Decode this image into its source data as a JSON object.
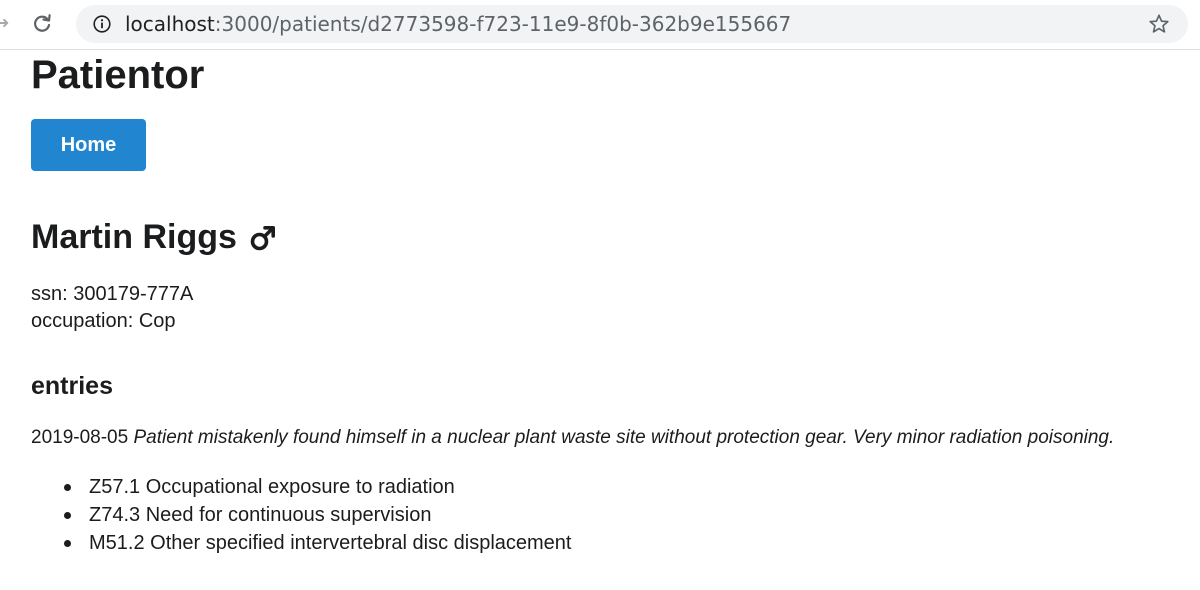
{
  "browser": {
    "url_host": "localhost",
    "url_path": ":3000/patients/d2773598-f723-11e9-8f0b-362b9e155667",
    "icons": {
      "back": "arrow-left-icon",
      "reload": "reload-icon",
      "info": "info-icon",
      "bookmark": "star-icon"
    }
  },
  "app": {
    "title": "Patientor",
    "home_button_label": "Home",
    "accent_color": "#2185d0"
  },
  "patient": {
    "name": "Martin Riggs",
    "gender_icon": "mars-icon",
    "ssn_label": "ssn:",
    "ssn": "300179-777A",
    "occupation_label": "occupation:",
    "occupation": "Cop"
  },
  "entries": {
    "heading": "entries",
    "items": [
      {
        "date": "2019-08-05",
        "description": "Patient mistakenly found himself in a nuclear plant waste site without protection gear. Very minor radiation poisoning.",
        "diagnoses": [
          {
            "code": "Z57.1",
            "name": "Occupational exposure to radiation"
          },
          {
            "code": "Z74.3",
            "name": "Need for continuous supervision"
          },
          {
            "code": "M51.2",
            "name": "Other specified intervertebral disc displacement"
          }
        ]
      }
    ]
  }
}
